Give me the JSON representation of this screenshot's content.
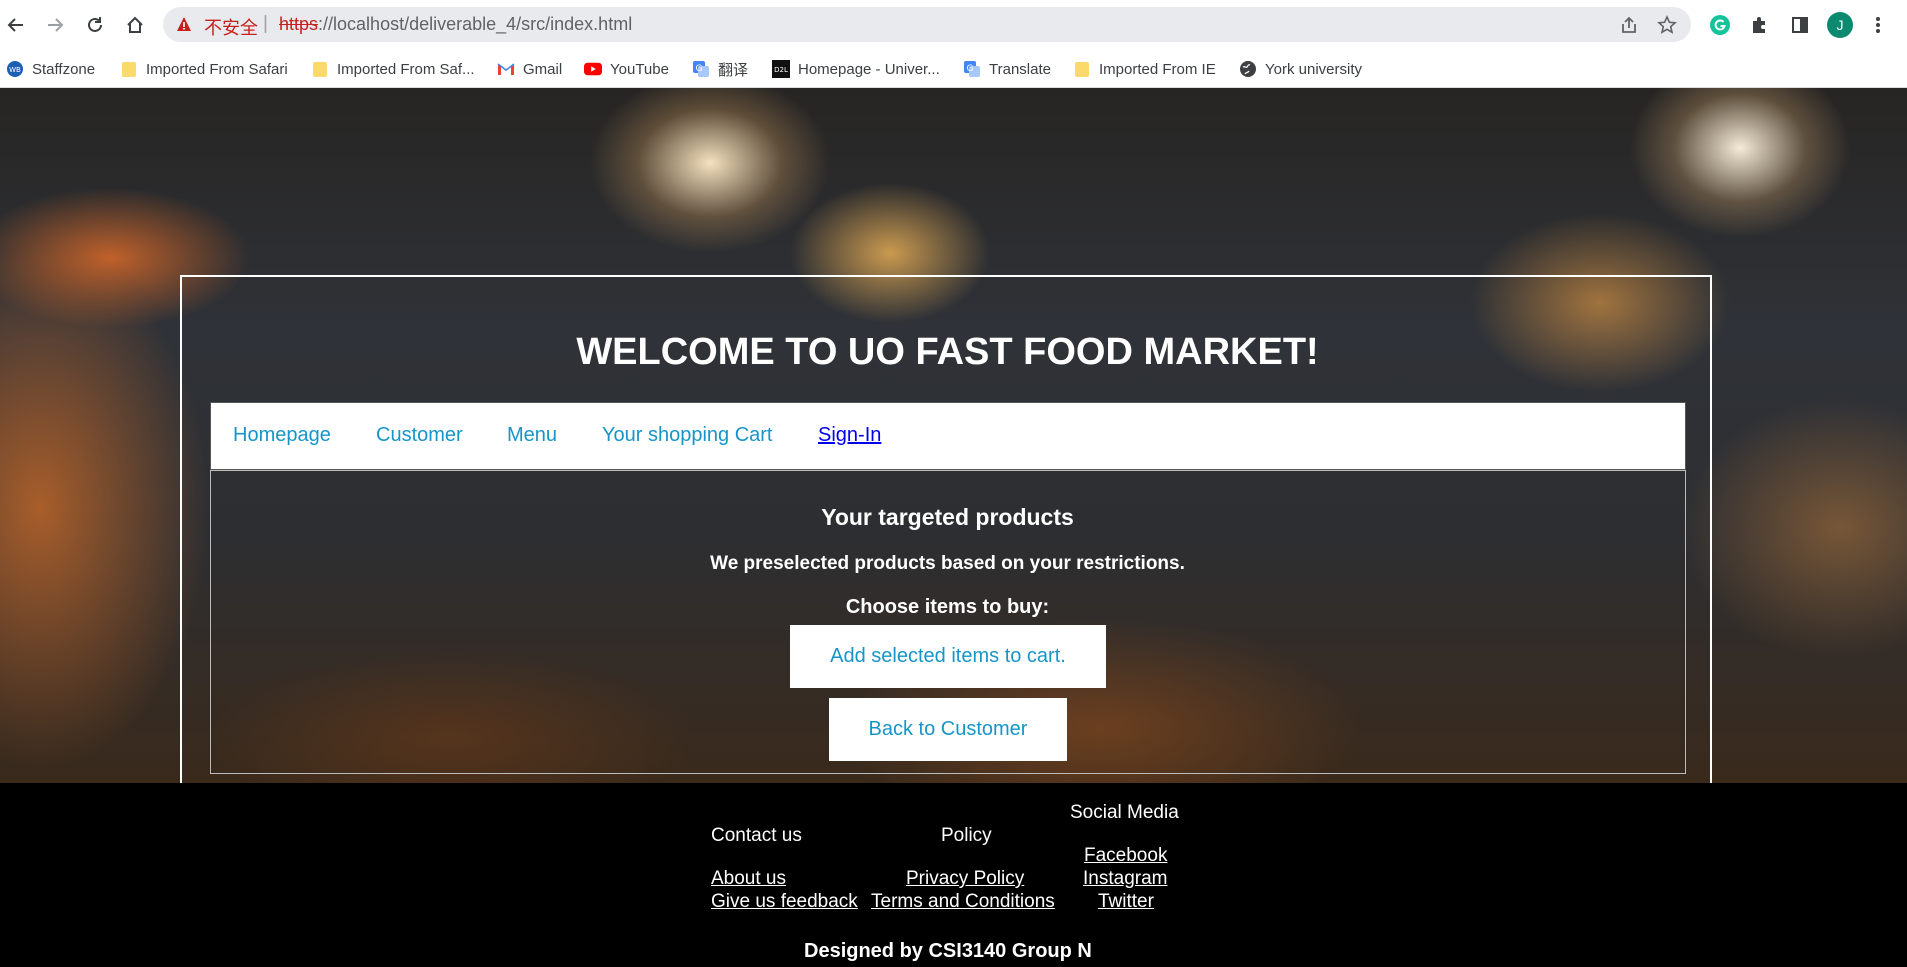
{
  "browser": {
    "security_label": "不安全",
    "url_scheme": "https",
    "url_rest": "://localhost/deliverable_4/src/index.html",
    "profile_initial": "J"
  },
  "bookmarks": [
    {
      "label": "Staffzone",
      "icon": "staffzone-icon"
    },
    {
      "label": "Imported From Safari",
      "icon": "folder-icon"
    },
    {
      "label": "Imported From Saf...",
      "icon": "folder-icon"
    },
    {
      "label": "Gmail",
      "icon": "gmail-icon"
    },
    {
      "label": "YouTube",
      "icon": "youtube-icon"
    },
    {
      "label": "翻译",
      "icon": "translate-icon"
    },
    {
      "label": "Homepage - Univer...",
      "icon": "d2l-icon"
    },
    {
      "label": "Translate",
      "icon": "translate-icon"
    },
    {
      "label": "Imported From IE",
      "icon": "folder-icon"
    },
    {
      "label": "York university",
      "icon": "globe-icon"
    }
  ],
  "page": {
    "title": "WELCOME TO UO FAST FOOD MARKET!",
    "nav": [
      "Homepage",
      "Customer",
      "Menu",
      "Your shopping Cart",
      "Sign-In"
    ],
    "heading": "Your targeted products",
    "subheading": "We preselected products based on your restrictions.",
    "choose_label": "Choose items to buy:",
    "add_button": "Add selected items to cart.",
    "back_button": "Back to Customer"
  },
  "footer": {
    "contact_heading": "Contact us",
    "policy_heading": "Policy",
    "social_heading": "Social Media",
    "about": "About us",
    "feedback": "Give us feedback",
    "privacy": "Privacy Policy",
    "terms": "Terms and Conditions",
    "facebook": "Facebook",
    "instagram": "Instagram",
    "twitter": "Twitter",
    "designed_by": "Designed by CSI3140 Group N"
  },
  "colors": {
    "link_blue": "#1795c9",
    "signin_link": "#0000ee",
    "footer_bg": "#000000",
    "profile_avatar": "#0b8a6f"
  }
}
